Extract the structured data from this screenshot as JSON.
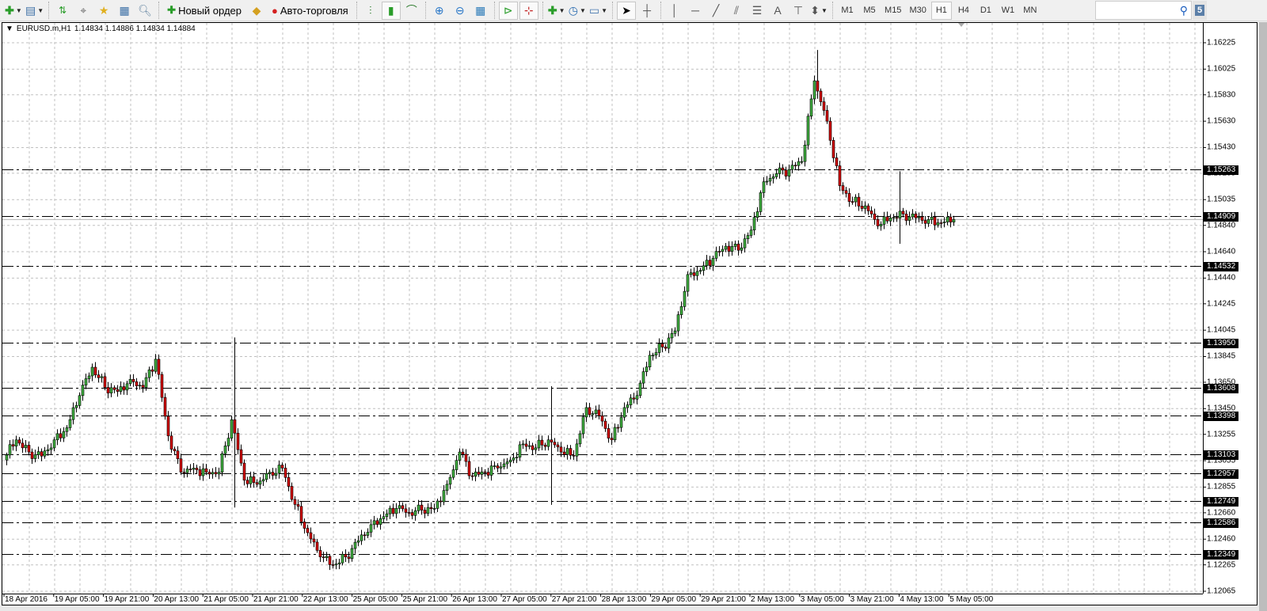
{
  "toolbar": {
    "new_order_label": "Новый ордер",
    "auto_trading_label": "Авто-торговля",
    "timeframes": [
      "M1",
      "M5",
      "M15",
      "M30",
      "H1",
      "H4",
      "D1",
      "W1",
      "MN"
    ],
    "active_timeframe": "H1",
    "notification_count": "5"
  },
  "chart_header": {
    "arrow": "▼",
    "symbol": "EURUSD.m,H1",
    "ohlc": "1.14834 1.14886 1.14834 1.14884"
  },
  "colors": {
    "bull": "#3fae3f",
    "bear": "#d40000",
    "level": "#000000",
    "grid": "#c0c0c0",
    "bid": "#b4b4b4"
  },
  "chart_data": {
    "type": "candlestick",
    "symbol": "EURUSD.m",
    "timeframe": "H1",
    "bars_per_waypoint": 4,
    "closes": [
      1.1306,
      1.13213,
      1.13121,
      1.1309,
      1.13213,
      1.13305,
      1.13549,
      1.13764,
      1.13611,
      1.1358,
      1.13672,
      1.13611,
      1.13825,
      1.13243,
      1.12968,
      1.12999,
      1.12968,
      1.12968,
      1.13366,
      1.12907,
      1.12876,
      1.12968,
      1.12999,
      1.12723,
      1.12509,
      1.12325,
      1.12264,
      1.12325,
      1.12448,
      1.1257,
      1.12631,
      1.12693,
      1.12662,
      1.1268,
      1.12693,
      1.12876,
      1.13121,
      1.12937,
      1.12968,
      1.12999,
      1.1306,
      1.13182,
      1.13152,
      1.13213,
      1.13121,
      1.1309,
      1.13458,
      1.13396,
      1.13213,
      1.13458,
      1.13549,
      1.13855,
      1.13917,
      1.14039,
      1.14467,
      1.14498,
      1.1459,
      1.14682,
      1.14651,
      1.14804,
      1.15171,
      1.15232,
      1.15263,
      1.15324,
      1.15936,
      1.1563,
      1.15141,
      1.15018,
      1.14988,
      1.14835,
      1.14896,
      1.14926,
      1.14896,
      1.14884,
      1.14859,
      1.14884
    ],
    "spikes": [
      {
        "bar": 72,
        "high": 1.1399,
        "low": 1.127
      },
      {
        "bar": 172,
        "high": 1.1362,
        "low": 1.1272
      },
      {
        "bar": 256,
        "high": 1.1617,
        "low": 1.158
      },
      {
        "bar": 282,
        "high": 1.1525,
        "low": 1.147
      }
    ],
    "ylim": [
      1.12,
      1.163
    ],
    "price_ticks": [
      "1.16225",
      "1.16025",
      "1.15830",
      "1.15630",
      "1.15430",
      "1.15235",
      "1.15035",
      "1.14840",
      "1.14640",
      "1.14440",
      "1.14245",
      "1.14045",
      "1.13845",
      "1.13650",
      "1.13450",
      "1.13255",
      "1.13055",
      "1.12855",
      "1.12660",
      "1.12460",
      "1.12265",
      "1.12065"
    ],
    "levels": [
      "1.15263",
      "1.14909",
      "1.14532",
      "1.13950",
      "1.13608",
      "1.13398",
      "1.13103",
      "1.12957",
      "1.12749",
      "1.12586",
      "1.12349"
    ],
    "bid": 1.14884,
    "time_labels": [
      "18 Apr 2016",
      "19 Apr 05:00",
      "19 Apr 21:00",
      "20 Apr 13:00",
      "21 Apr 05:00",
      "21 Apr 21:00",
      "22 Apr 13:00",
      "25 Apr 05:00",
      "25 Apr 21:00",
      "26 Apr 13:00",
      "27 Apr 05:00",
      "27 Apr 21:00",
      "28 Apr 13:00",
      "29 Apr 05:00",
      "29 Apr 21:00",
      "2 May 13:00",
      "3 May 05:00",
      "3 May 21:00",
      "4 May 13:00",
      "5 May 05:00"
    ],
    "grid": true
  }
}
